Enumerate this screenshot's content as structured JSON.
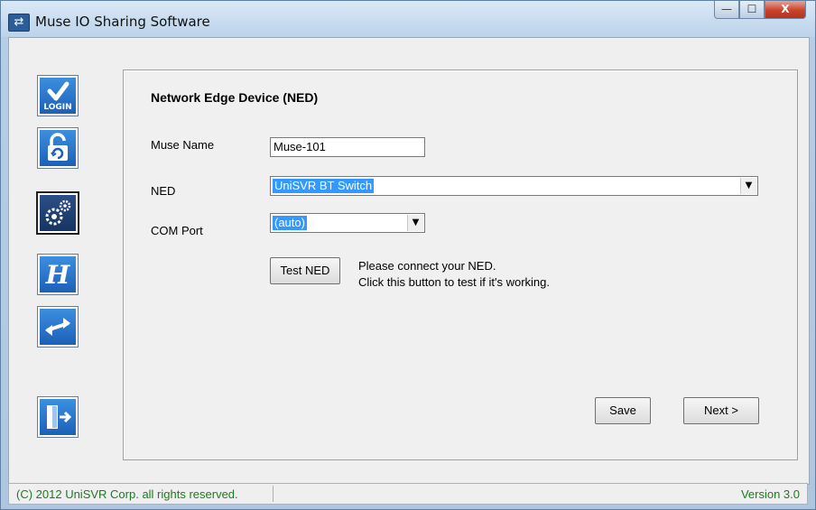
{
  "window": {
    "title": "Muse IO Sharing Software",
    "icon": "double-arrow-icon",
    "controls": {
      "minimize": "—",
      "maximize": "☐",
      "close": "X"
    }
  },
  "sidebar": {
    "items": [
      {
        "name": "login",
        "icon": "checkmark-login-icon",
        "label": "LOGIN"
      },
      {
        "name": "lock",
        "icon": "lock-refresh-icon"
      },
      {
        "name": "settings",
        "icon": "gears-icon",
        "active": true
      },
      {
        "name": "history",
        "icon": "script-h-icon"
      },
      {
        "name": "sharing",
        "icon": "exchange-arrows-icon"
      },
      {
        "name": "exit",
        "icon": "exit-door-icon"
      }
    ]
  },
  "panel": {
    "title": "Network Edge Device (NED)",
    "muse_name": {
      "label": "Muse Name",
      "value": "Muse-101"
    },
    "ned": {
      "label": "NED",
      "value": "UniSVR BT Switch"
    },
    "com_port": {
      "label": "COM Port",
      "value": "(auto)"
    },
    "test_button": "Test NED",
    "hint_line1": "Please connect your NED.",
    "hint_line2": "Click this button to test if it's working.",
    "save_button": "Save",
    "next_button": "Next >"
  },
  "status": {
    "copyright": "(C) 2012 UniSVR Corp. all rights reserved.",
    "version": "Version 3.0"
  },
  "colors": {
    "selection": "#3399ff",
    "status_text": "#1f7a1f",
    "icon_blue": "#1d5fb8"
  }
}
